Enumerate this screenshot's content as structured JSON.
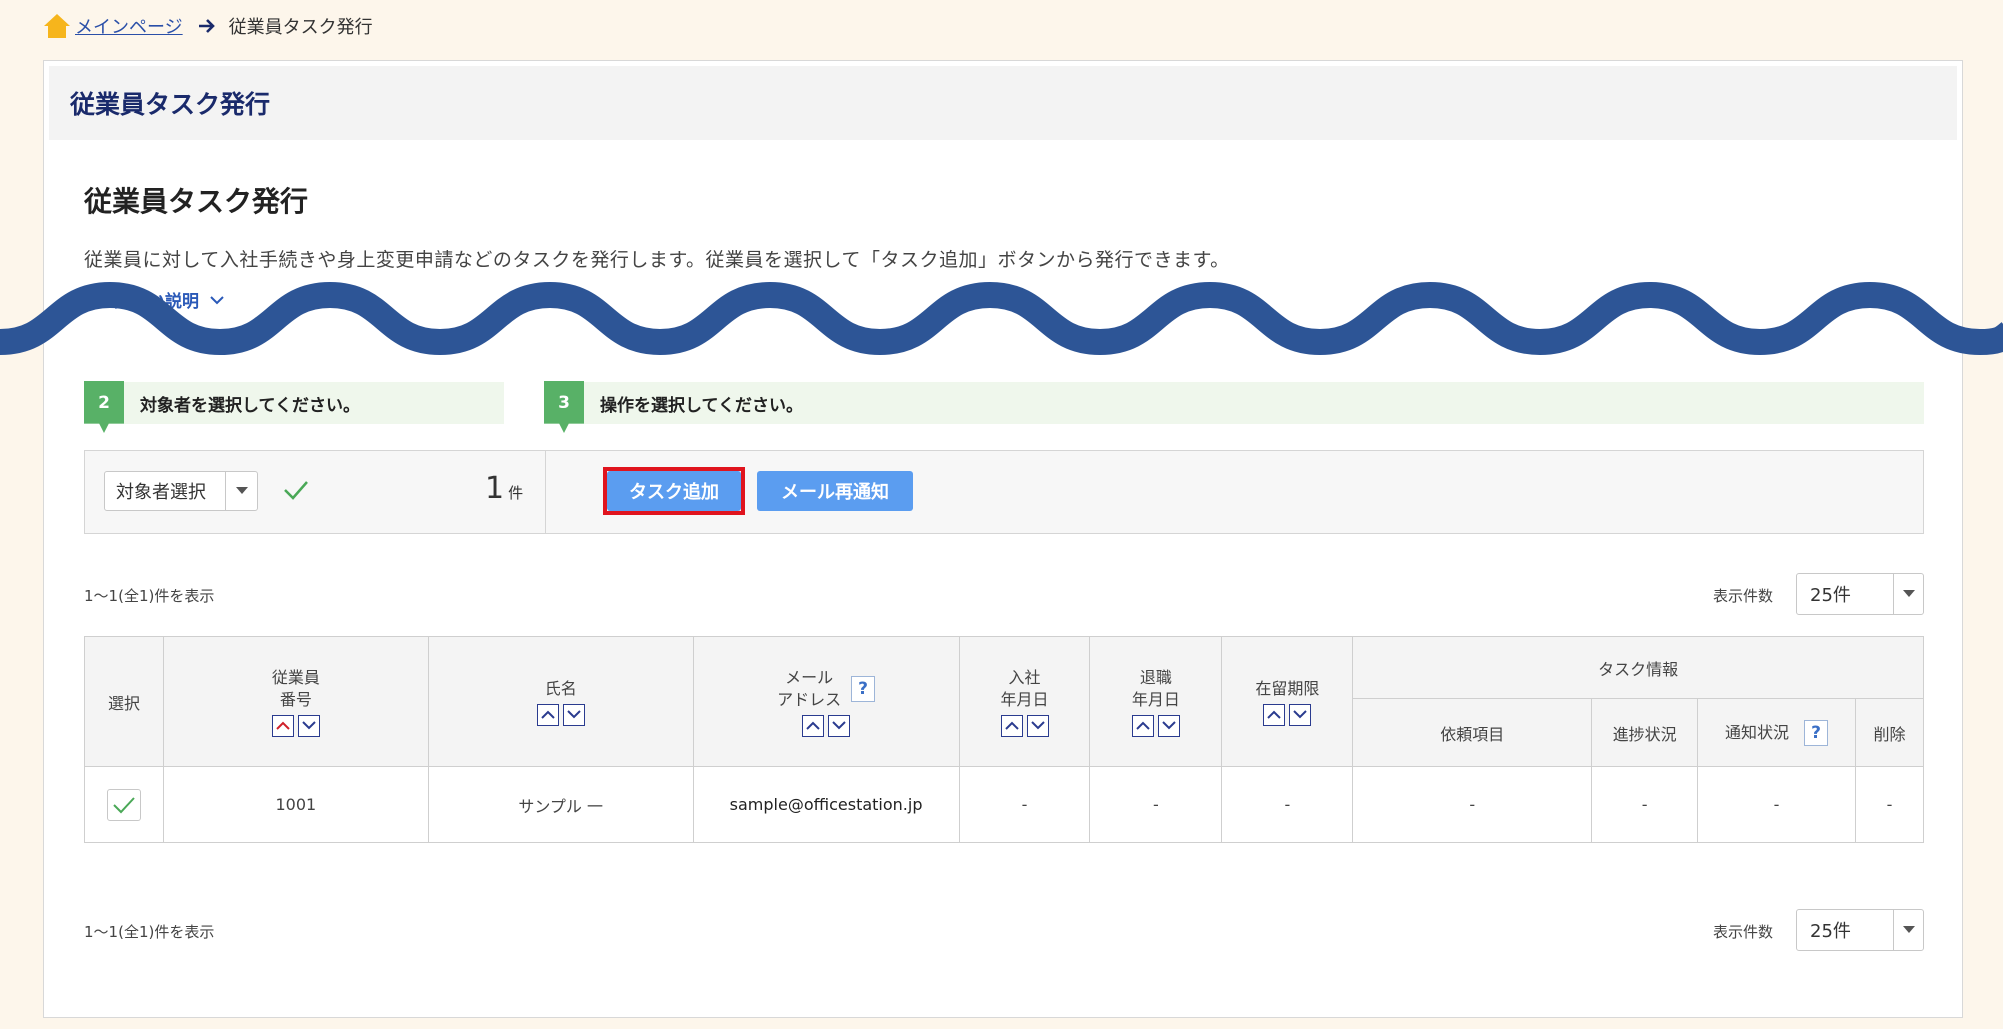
{
  "breadcrumb": {
    "home_label": "メインページ",
    "current": "従業員タスク発行"
  },
  "card": {
    "header_title": "従業員タスク発行",
    "section_title": "従業員タスク発行",
    "description": "従業員に対して入社手続きや身上変更申請などのタスクを発行します。従業員を選択して「タスク追加」ボタンから発行できます。",
    "explain_toggle": "詳しい説明"
  },
  "steps": [
    {
      "num": "2",
      "label": "対象者を選択してください。"
    },
    {
      "num": "3",
      "label": "操作を選択してください。"
    }
  ],
  "action_bar": {
    "target_select": "対象者選択",
    "count": "1",
    "count_unit": "件",
    "task_add_button": "タスク追加",
    "mail_resend_button": "メール再通知"
  },
  "listing": {
    "range_text": "1〜1(全1)件を表示",
    "per_page_label": "表示件数",
    "per_page_value": "25件"
  },
  "table": {
    "headers": {
      "select": "選択",
      "emp_no_1": "従業員",
      "emp_no_2": "番号",
      "name": "氏名",
      "email_1": "メール",
      "email_2": "アドレス",
      "hire_1": "入社",
      "hire_2": "年月日",
      "leave_1": "退職",
      "leave_2": "年月日",
      "residence": "在留期限",
      "task_info": "タスク情報",
      "request_item": "依頼項目",
      "progress": "進捗状況",
      "notify": "通知状況",
      "delete": "削除",
      "help": "?"
    },
    "rows": [
      {
        "emp_no": "1001",
        "name": "サンプル 一",
        "email": "sample@officestation.jp",
        "hire": "-",
        "leave": "-",
        "residence": "-",
        "request_item": "-",
        "progress": "-",
        "notify": "-",
        "delete": "-"
      }
    ]
  },
  "colors": {
    "accent_blue": "#5b9df0",
    "step_green": "#58b167",
    "wave_blue": "#2d5596",
    "highlight_red": "#e0141e",
    "header_navy": "#1a2a6b"
  }
}
